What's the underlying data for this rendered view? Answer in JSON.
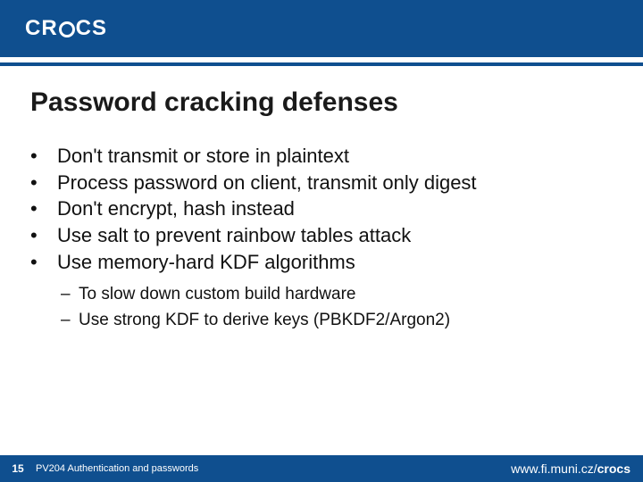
{
  "header": {
    "logo_text_left": "CR",
    "logo_text_right": "CS"
  },
  "title": "Password cracking defenses",
  "bullets": [
    "Don't transmit or store in plaintext",
    "Process password on client, transmit only digest",
    "Don't encrypt, hash instead",
    "Use salt to prevent rainbow tables attack",
    "Use memory-hard KDF algorithms"
  ],
  "sub_bullets": [
    "To slow down custom build hardware",
    "Use strong KDF to derive keys (PBKDF2/Argon2)"
  ],
  "footer": {
    "page_number": "15",
    "course": "PV204 Authentication and passwords",
    "url_prefix": "www.fi.muni.cz/",
    "url_bold": "crocs"
  }
}
